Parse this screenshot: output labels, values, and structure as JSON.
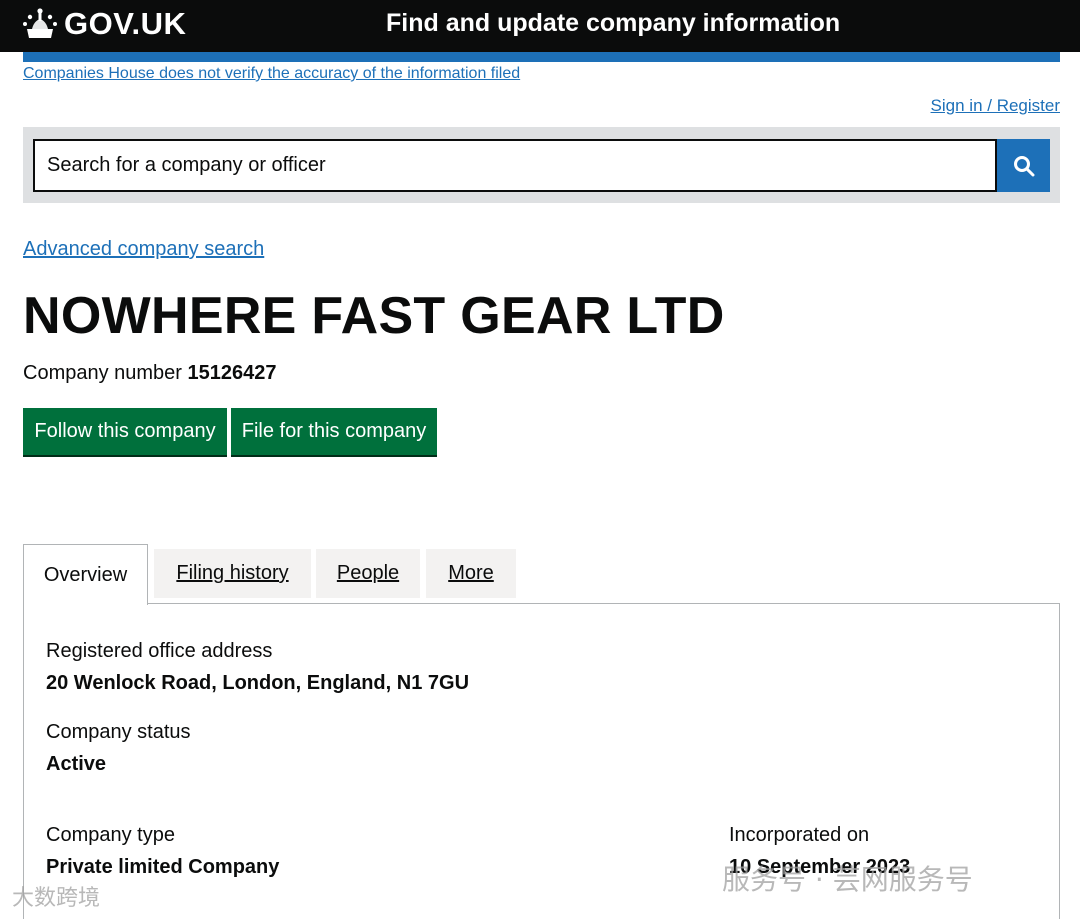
{
  "header": {
    "logo_text": "GOV.UK",
    "service_name": "Find and update company information"
  },
  "disclaimer": "Companies House does not verify the accuracy of the information filed",
  "sign_in": "Sign in / Register",
  "search": {
    "placeholder": "Search for a company or officer",
    "icon": "search-icon"
  },
  "advanced_search": "Advanced company search",
  "company": {
    "name": "NOWHERE FAST GEAR LTD",
    "number_label": "Company number",
    "number": "15126427"
  },
  "buttons": {
    "follow": "Follow this company",
    "file": "File for this company"
  },
  "tabs": [
    {
      "label": "Overview",
      "selected": true
    },
    {
      "label": "Filing history",
      "selected": false
    },
    {
      "label": "People",
      "selected": false
    },
    {
      "label": "More",
      "selected": false
    }
  ],
  "overview": {
    "address_label": "Registered office address",
    "address": "20 Wenlock Road, London, England, N1 7GU",
    "status_label": "Company status",
    "status": "Active",
    "type_label": "Company type",
    "type": "Private limited Company",
    "incorporated_label": "Incorporated on",
    "incorporated": "10 September 2023"
  },
  "watermarks": {
    "left": "大数跨境",
    "right": "服务号 · 芸网服务号"
  },
  "colors": {
    "header_bg": "#0b0c0c",
    "link": "#1d70b8",
    "button_green": "#00703c",
    "search_bg": "#dee0e2",
    "tab_bg": "#f3f2f1"
  }
}
